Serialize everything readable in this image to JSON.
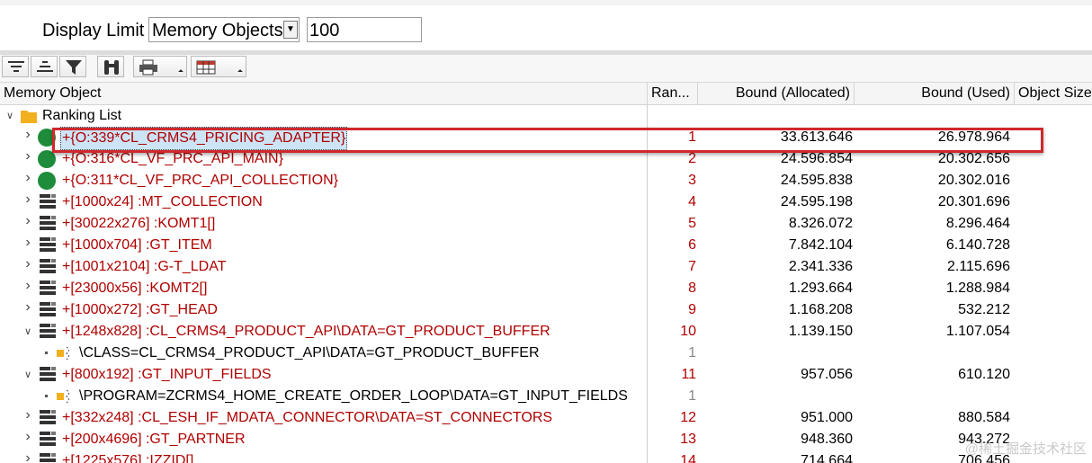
{
  "display_limit": {
    "label": "Display Limit",
    "mode": "Memory Objects",
    "count": "100"
  },
  "toolbar": {
    "buttons": [
      {
        "icon": "sort-ascending-icon"
      },
      {
        "icon": "sort-descending-icon"
      },
      {
        "icon": "filter-icon"
      },
      {
        "icon": "find-binoculars-icon"
      },
      {
        "icon": "print-icon",
        "has_dropdown": true
      },
      {
        "icon": "layout-table-icon",
        "has_dropdown": true
      }
    ]
  },
  "columns": {
    "object": "Memory Object",
    "rank": "Ran...",
    "alloc": "Bound (Allocated)",
    "used": "Bound (Used)",
    "size": "Object Size"
  },
  "tree": {
    "root_label": "Ranking List",
    "rows": [
      {
        "type": "object",
        "expanded": false,
        "name": "+{O:339*CL_CRMS4_PRICING_ADAPTER}",
        "rank": "1",
        "alloc": "33.613.646",
        "used": "26.978.964",
        "selected": true
      },
      {
        "type": "object",
        "expanded": false,
        "name": "+{O:316*CL_VF_PRC_API_MAIN}",
        "rank": "2",
        "alloc": "24.596.854",
        "used": "20.302.656"
      },
      {
        "type": "object",
        "expanded": false,
        "name": "+{O:311*CL_VF_PRC_API_COLLECTION}",
        "rank": "3",
        "alloc": "24.595.838",
        "used": "20.302.016"
      },
      {
        "type": "table",
        "expanded": false,
        "name": "+[1000x24] :MT_COLLECTION",
        "rank": "4",
        "alloc": "24.595.198",
        "used": "20.301.696"
      },
      {
        "type": "table",
        "expanded": false,
        "name": "+[30022x276] :KOMT1[]",
        "rank": "5",
        "alloc": "8.326.072",
        "used": "8.296.464"
      },
      {
        "type": "table",
        "expanded": false,
        "name": "+[1000x704] :GT_ITEM",
        "rank": "6",
        "alloc": "7.842.104",
        "used": "6.140.728"
      },
      {
        "type": "table",
        "expanded": false,
        "name": "+[1001x2104] :G-T_LDAT",
        "rank": "7",
        "alloc": "2.341.336",
        "used": "2.115.696"
      },
      {
        "type": "table",
        "expanded": false,
        "name": "+[23000x56] :KOMT2[]",
        "rank": "8",
        "alloc": "1.293.664",
        "used": "1.288.984"
      },
      {
        "type": "table",
        "expanded": false,
        "name": "+[1000x272] :GT_HEAD",
        "rank": "9",
        "alloc": "1.168.208",
        "used": "532.212"
      },
      {
        "type": "table",
        "expanded": true,
        "name": "+[1248x828] :CL_CRMS4_PRODUCT_API\\DATA=GT_PRODUCT_BUFFER",
        "rank": "10",
        "alloc": "1.139.150",
        "used": "1.107.054"
      },
      {
        "type": "ref",
        "name": "\\CLASS=CL_CRMS4_PRODUCT_API\\DATA=GT_PRODUCT_BUFFER",
        "rank": "1",
        "alloc": "",
        "used": ""
      },
      {
        "type": "table",
        "expanded": true,
        "name": "+[800x192] :GT_INPUT_FIELDS",
        "rank": "11",
        "alloc": "957.056",
        "used": "610.120"
      },
      {
        "type": "ref",
        "name": "\\PROGRAM=ZCRMS4_HOME_CREATE_ORDER_LOOP\\DATA=GT_INPUT_FIELDS",
        "rank": "1",
        "alloc": "",
        "used": ""
      },
      {
        "type": "table",
        "expanded": false,
        "name": "+[332x248] :CL_ESH_IF_MDATA_CONNECTOR\\DATA=ST_CONNECTORS",
        "rank": "12",
        "alloc": "951.000",
        "used": "880.584"
      },
      {
        "type": "table",
        "expanded": false,
        "name": "+[200x4696] :GT_PARTNER",
        "rank": "13",
        "alloc": "948.360",
        "used": "943.272"
      },
      {
        "type": "table",
        "expanded": false,
        "name": "+[1225x576] :IZZID[]",
        "rank": "14",
        "alloc": "714.664",
        "used": "706.456"
      }
    ]
  },
  "watermark": "@稀土掘金技术社区",
  "colors": {
    "name_red": "#b00000",
    "highlight_box": "#d0282c",
    "object_green": "#1e8c3a",
    "folder_yellow": "#f2b01e",
    "selection_blue": "#cde4f7"
  }
}
